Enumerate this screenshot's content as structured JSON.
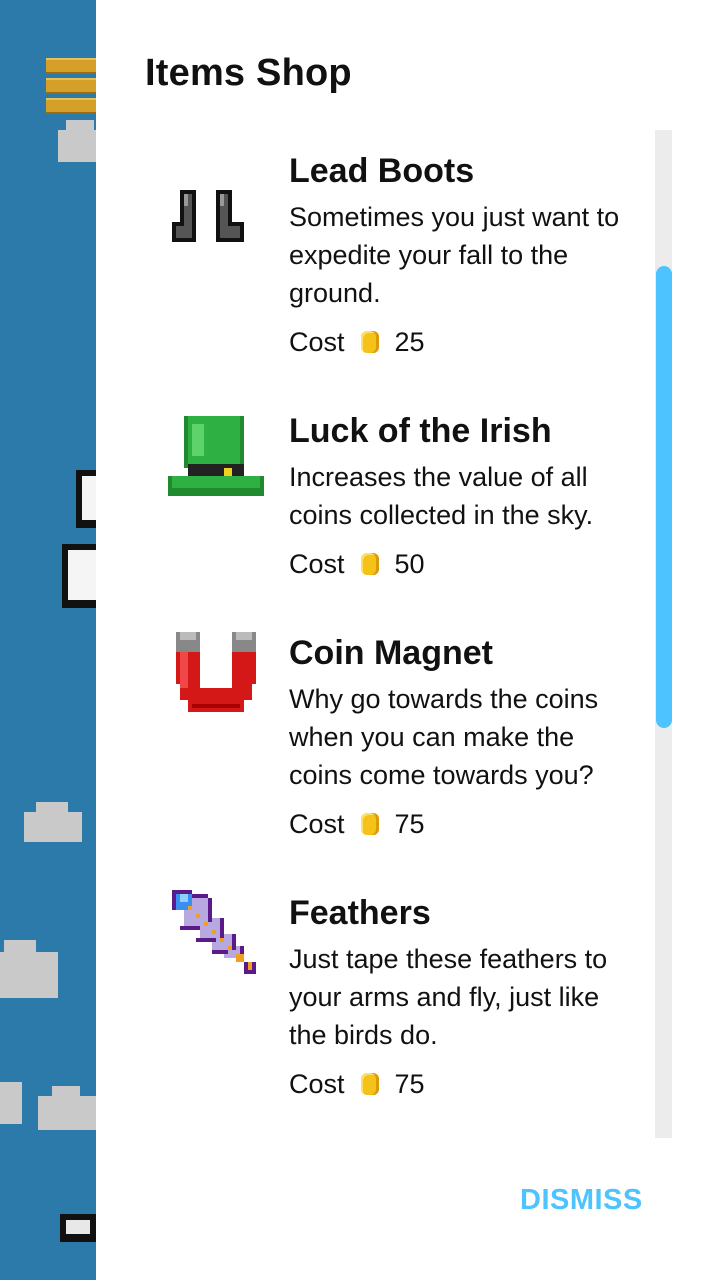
{
  "dialog": {
    "title": "Items Shop",
    "dismiss_label": "DISMISS"
  },
  "items": [
    {
      "name": "Lead Boots",
      "description": "Sometimes you just want to expedite your fall to the ground.",
      "cost_label": "Cost",
      "cost": "25",
      "icon": "lead-boots-icon"
    },
    {
      "name": "Luck of the Irish",
      "description": "Increases the value of all coins collected in the sky.",
      "cost_label": "Cost",
      "cost": "50",
      "icon": "leprechaun-hat-icon"
    },
    {
      "name": "Coin Magnet",
      "description": "Why go towards the coins when you can make the coins come towards you?",
      "cost_label": "Cost",
      "cost": "75",
      "icon": "magnet-icon"
    },
    {
      "name": "Feathers",
      "description": "Just tape these feathers to your arms and fly, just like the birds do.",
      "cost_label": "Cost",
      "cost": "75",
      "icon": "feather-icon"
    }
  ],
  "colors": {
    "accent": "#4dc3ff",
    "coin": "#f5c21a",
    "background_scene": "#2b7aa9"
  }
}
